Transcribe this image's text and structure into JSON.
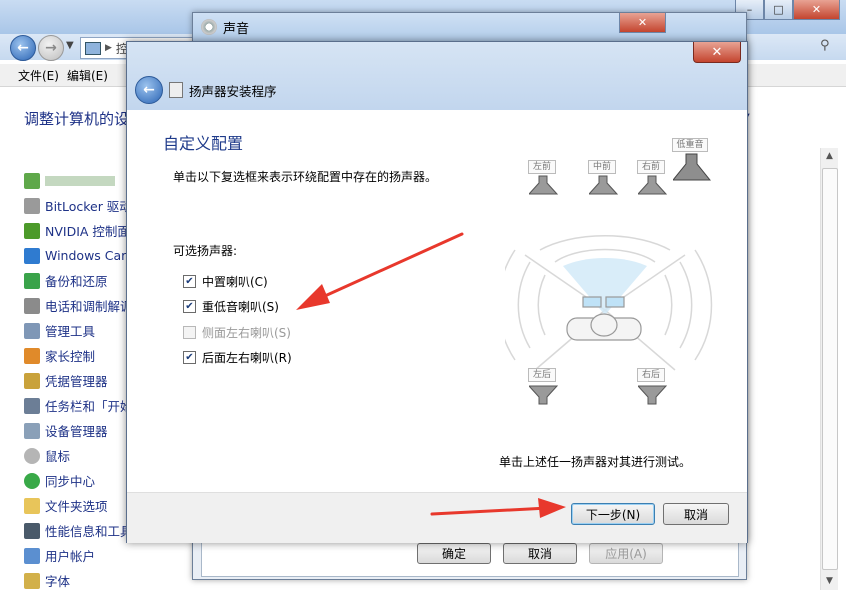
{
  "control_panel": {
    "address": "控制面板",
    "menu": [
      "文件(E)",
      "编辑(E)"
    ],
    "heading": "调整计算机的设",
    "items": [
      {
        "label": "",
        "icon": "blurred-item-icon"
      },
      {
        "label": "BitLocker 驱动",
        "icon": "bitlocker-icon"
      },
      {
        "label": "NVIDIA 控制面",
        "icon": "nvidia-icon"
      },
      {
        "label": "Windows Card",
        "icon": "windows-cardspace-icon"
      },
      {
        "label": "备份和还原",
        "icon": "backup-icon"
      },
      {
        "label": "电话和调制解调",
        "icon": "phone-modem-icon"
      },
      {
        "label": "管理工具",
        "icon": "admin-tools-icon"
      },
      {
        "label": "家长控制",
        "icon": "parental-controls-icon"
      },
      {
        "label": "凭据管理器",
        "icon": "credential-manager-icon"
      },
      {
        "label": "任务栏和「开始",
        "icon": "taskbar-icon"
      },
      {
        "label": "设备管理器",
        "icon": "device-manager-icon"
      },
      {
        "label": "鼠标",
        "icon": "mouse-icon"
      },
      {
        "label": "同步中心",
        "icon": "sync-center-icon"
      },
      {
        "label": "文件夹选项",
        "icon": "folder-options-icon"
      },
      {
        "label": "性能信息和工具",
        "icon": "performance-icon"
      },
      {
        "label": "用户帐户",
        "icon": "user-accounts-icon"
      },
      {
        "label": "字体",
        "icon": "fonts-icon"
      }
    ]
  },
  "sound_dialog": {
    "title": "声音",
    "ok": "确定",
    "cancel": "取消",
    "apply": "应用(A)"
  },
  "wizard": {
    "title": "扬声器安装程序",
    "heading": "自定义配置",
    "instruction": "单击以下复选框来表示环绕配置中存在的扬声器。",
    "optional_label": "可选扬声器:",
    "checkboxes": [
      {
        "label": "中置喇叭(C)",
        "checked": true,
        "enabled": true
      },
      {
        "label": "重低音喇叭(S)",
        "checked": true,
        "enabled": true
      },
      {
        "label": "侧面左右喇叭(S)",
        "checked": false,
        "enabled": false
      },
      {
        "label": "后面左右喇叭(R)",
        "checked": true,
        "enabled": true
      }
    ],
    "speakers": {
      "front_left": "左前",
      "front_center": "中前",
      "front_right": "右前",
      "subwoofer": "低重音",
      "rear_left": "左后",
      "rear_right": "右后"
    },
    "test_hint": "单击上述任一扬声器对其进行测试。",
    "next": "下一步(N)",
    "cancel": "取消"
  },
  "colors": {
    "annotation_arrow": "#e8382c",
    "link_blue": "#1e3287",
    "heading_blue": "#1e3a8a"
  }
}
